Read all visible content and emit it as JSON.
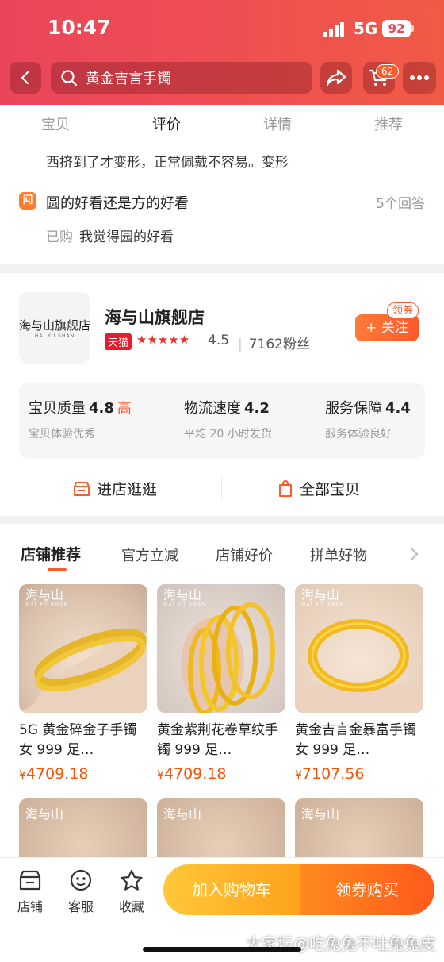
{
  "status_bar": {
    "time": "10:47",
    "network": "5G",
    "battery": "92"
  },
  "header": {
    "search_text": "黄金吉言手镯",
    "cart_count": "62",
    "icons": [
      "back-icon",
      "search-icon",
      "share-icon",
      "cart-icon",
      "more-icon"
    ]
  },
  "tabs": [
    {
      "label": "宝贝",
      "active": false
    },
    {
      "label": "评价",
      "active": true
    },
    {
      "label": "详情",
      "active": false
    },
    {
      "label": "推荐",
      "active": false
    }
  ],
  "qa": {
    "previous_text": "西挤到了才变形，正常佩戴不容易。变形",
    "question_icon": "问",
    "question": "圆的好看还是方的好看",
    "answer_count": "5个回答",
    "answer_tag": "已购",
    "answer": "我觉得园的好看"
  },
  "store": {
    "logo_text": "海与山旗舰店",
    "logo_sub": "HAI YU SHAN",
    "name": "海与山旗舰店",
    "badge": "天猫",
    "stars": "★★★★★",
    "rating": "4.5",
    "fans": "7162粉丝",
    "follow_label": "+ 关注",
    "coupon_label": "领券",
    "scores": [
      {
        "title": "宝贝质量",
        "value": "4.8",
        "level": "高",
        "sub": "宝贝体验优秀"
      },
      {
        "title": "物流速度",
        "value": "4.2",
        "level": "",
        "sub": "平均 20 小时发货"
      },
      {
        "title": "服务保障",
        "value": "4.4",
        "level": "",
        "sub": "服务体验良好"
      }
    ],
    "visit_label": "进店逛逛",
    "all_items_label": "全部宝贝"
  },
  "recommend": {
    "tabs": [
      "店铺推荐",
      "官方立减",
      "店铺好价",
      "拼单好物"
    ],
    "watermark": "海与山",
    "watermark_sub": "HAI YU SHAN",
    "products": [
      {
        "title": "5G 黄金碎金子手镯女 999 足…",
        "currency": "¥",
        "price": "4709.18"
      },
      {
        "title": "黄金紫荆花卷草纹手镯 999 足…",
        "currency": "¥",
        "price": "4709.18"
      },
      {
        "title": "黄金吉言金暴富手镯女 999 足…",
        "currency": "¥",
        "price": "7107.56"
      }
    ]
  },
  "bottom_bar": {
    "shop": "店铺",
    "service": "客服",
    "favorite": "收藏",
    "add_cart": "加入购物车",
    "buy": "领券购买"
  },
  "watermark": "大家坛@吃兔兔不吐兔兔皮",
  "colors": {
    "brand_red": "#e9465a",
    "accent_orange": "#ff5a2c",
    "price": "#ff5000",
    "cart_yellow": "#ffb52a"
  }
}
